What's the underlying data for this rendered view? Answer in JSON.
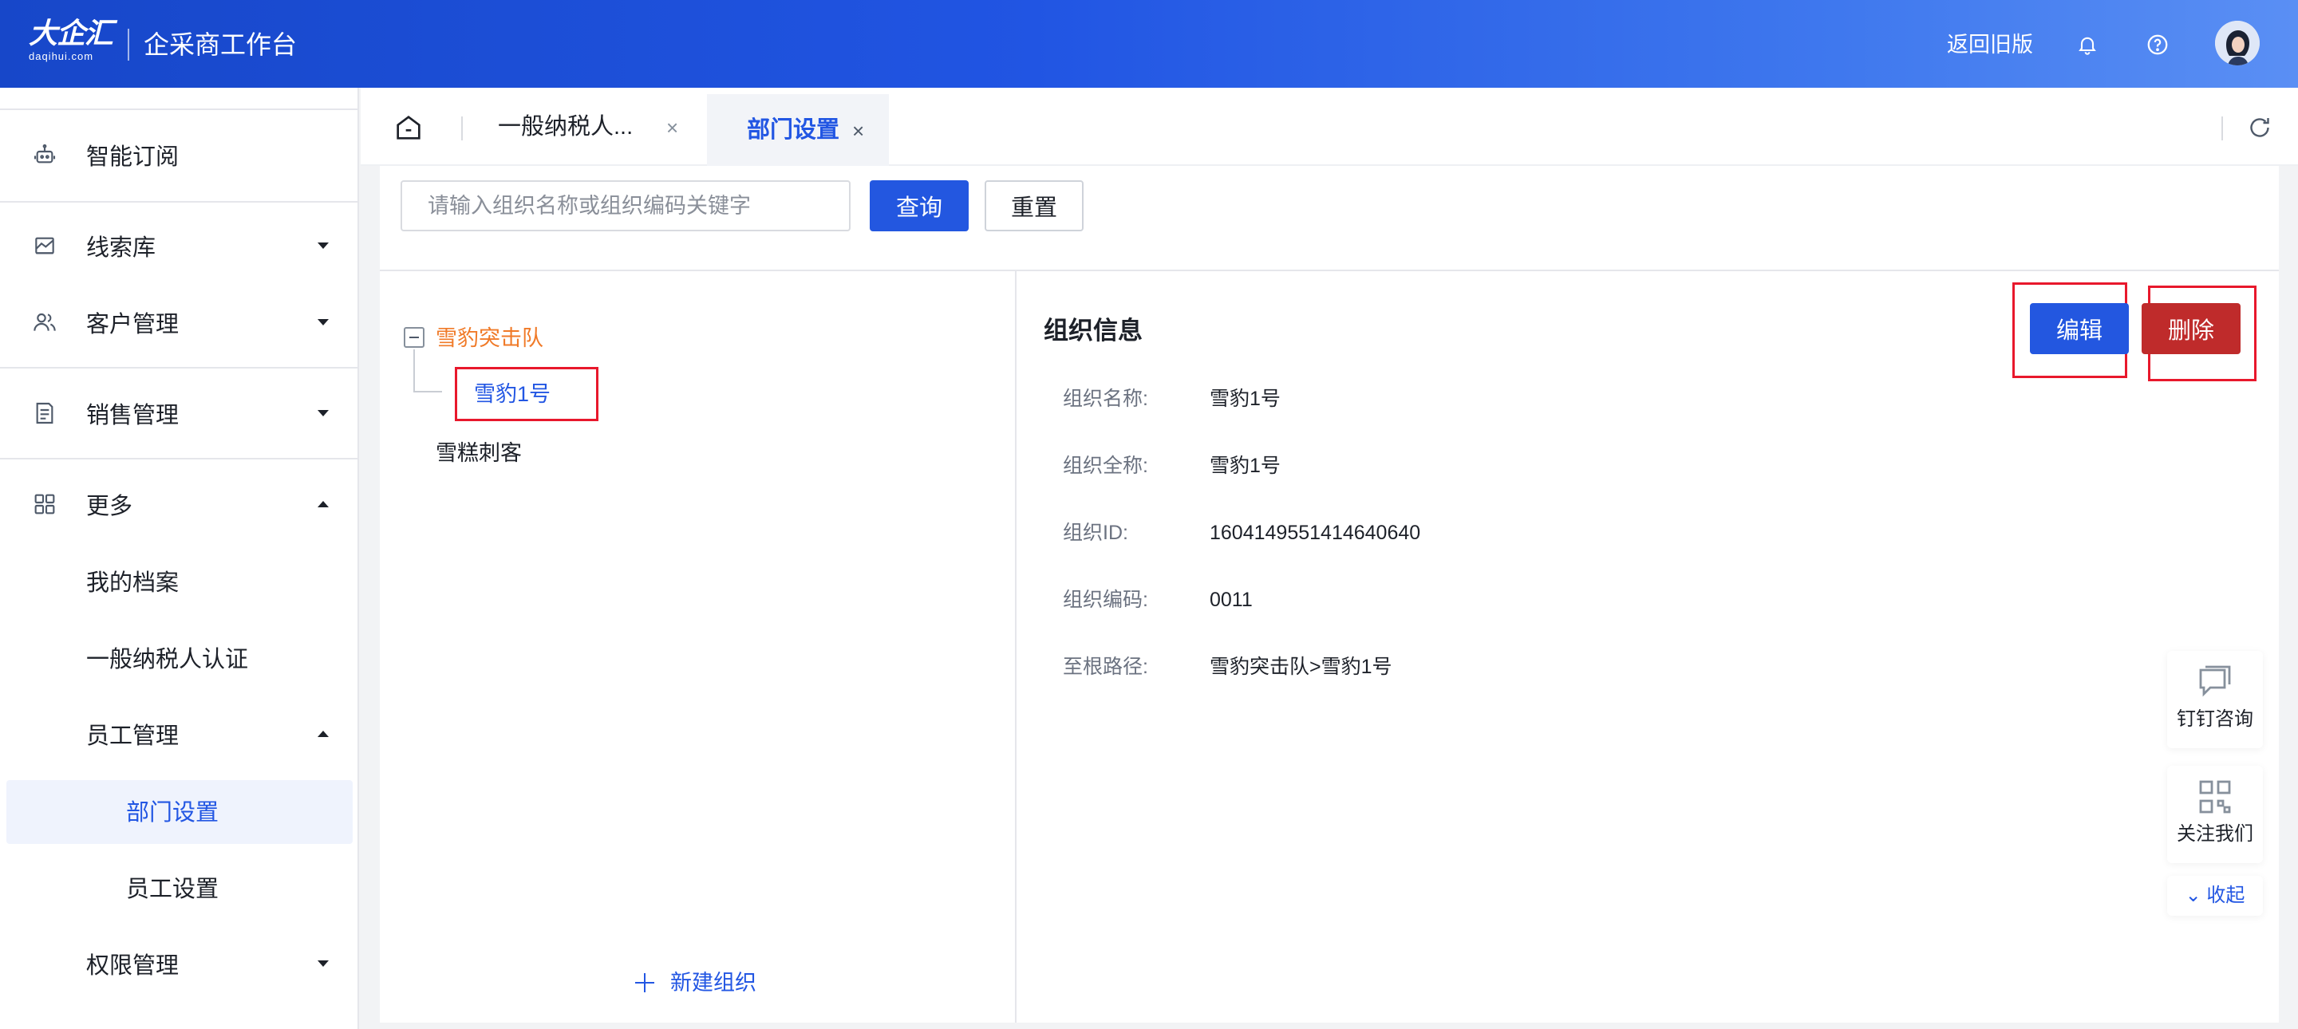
{
  "header": {
    "logo_text": "大企汇",
    "logo_sub": "daqihui.com",
    "app_title": "企采商工作台",
    "return_old": "返回旧版"
  },
  "sidebar": {
    "items": [
      {
        "label": "智能订阅"
      },
      {
        "label": "线索库"
      },
      {
        "label": "客户管理"
      },
      {
        "label": "销售管理"
      },
      {
        "label": "更多"
      },
      {
        "label": "我的档案"
      },
      {
        "label": "一般纳税人认证"
      },
      {
        "label": "员工管理"
      },
      {
        "label": "部门设置"
      },
      {
        "label": "员工设置"
      },
      {
        "label": "权限管理"
      }
    ]
  },
  "tabs": [
    {
      "label": "一般纳税人...",
      "close": "×"
    },
    {
      "label": "部门设置",
      "close": "×"
    }
  ],
  "search": {
    "placeholder": "请输入组织名称或组织编码关键字",
    "value": "",
    "query_label": "查询",
    "reset_label": "重置"
  },
  "tree": {
    "root": "雪豹突击队",
    "child": "雪豹1号",
    "other": "雪糕刺客",
    "new_org": "新建组织"
  },
  "info": {
    "title": "组织信息",
    "edit_label": "编辑",
    "delete_label": "删除",
    "fields": [
      {
        "label": "组织名称:",
        "value": "雪豹1号"
      },
      {
        "label": "组织全称:",
        "value": "雪豹1号"
      },
      {
        "label": "组织ID:",
        "value": "1604149551414640640"
      },
      {
        "label": "组织编码:",
        "value": "0011"
      },
      {
        "label": "至根路径:",
        "value": "雪豹突击队>雪豹1号"
      }
    ]
  },
  "float": {
    "consult": "钉钉咨询",
    "follow": "关注我们",
    "collapse": "收起"
  },
  "colors": {
    "primary": "#2357e0",
    "danger": "#bf2b2b",
    "tree_root": "#f07a28",
    "highlight": "#e8182c"
  }
}
